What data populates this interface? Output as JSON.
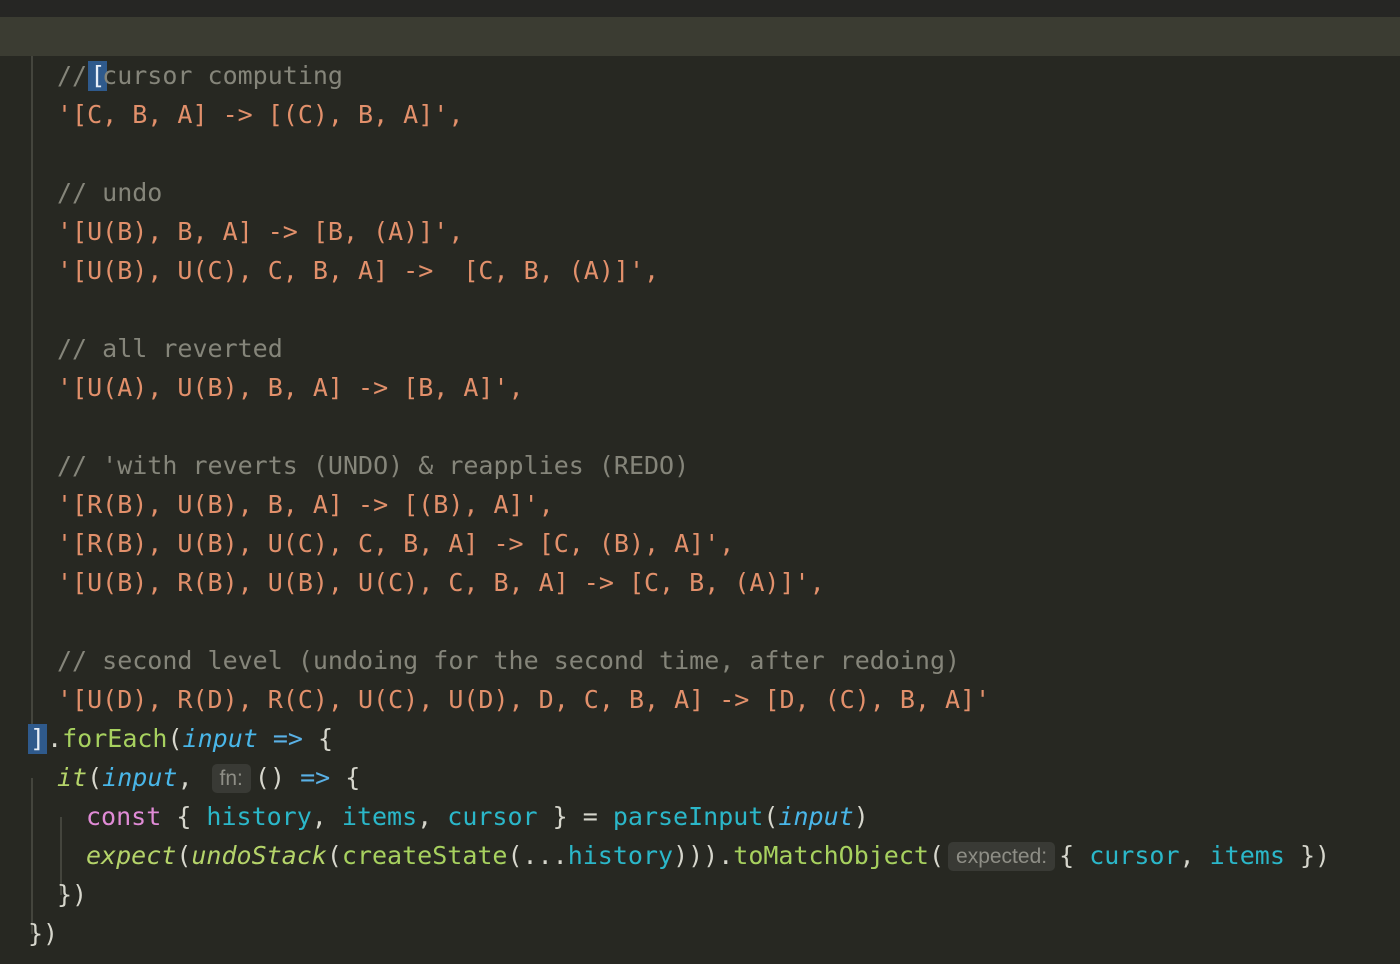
{
  "code": {
    "open_bracket": "[",
    "comment_1": "// cursor computing",
    "string_1": "'[C, B, A] -> [(C), B, A]',",
    "comment_2": "// undo",
    "string_2": "'[U(B), B, A] -> [B, (A)]',",
    "string_3": "'[U(B), U(C), C, B, A] ->  [C, B, (A)]',",
    "comment_3": "// all reverted",
    "string_4": "'[U(A), U(B), B, A] -> [B, A]',",
    "comment_4": "// 'with reverts (UNDO) & reapplies (REDO)",
    "string_5": "'[R(B), U(B), B, A] -> [(B), A]',",
    "string_6": "'[R(B), U(B), U(C), C, B, A] -> [C, (B), A]',",
    "string_7": "'[U(B), R(B), U(B), U(C), C, B, A] -> [C, B, (A)]',",
    "comment_5": "// second level (undoing for the second time, after redoing)",
    "string_8": "'[U(D), R(D), R(C), U(C), U(D), D, C, B, A] -> [D, (C), B, A]'",
    "close_bracket": "]",
    "foreach_dot": ".",
    "foreach_fn": "forEach",
    "foreach_open_paren": "(",
    "foreach_param": "input",
    "foreach_arrow": " => ",
    "foreach_brace": "{",
    "it_fn": "it",
    "it_open": "(",
    "it_param": "input",
    "it_comma": ", ",
    "it_hint": "fn:",
    "it_parens": "() ",
    "it_arrow": "=> ",
    "it_brace": "{",
    "const_kw": "const",
    "const_open": " { ",
    "history_var": "history",
    "comma_a": ", ",
    "items_var": "items",
    "comma_b": ", ",
    "cursor_var": "cursor",
    "const_close": " } = ",
    "parse_fn": "parseInput",
    "parse_open": "(",
    "parse_param": "input",
    "parse_close": ")",
    "expect_fn": "expect",
    "expect_open": "(",
    "undo_fn": "undoStack",
    "undo_open": "(",
    "create_fn": "createState",
    "create_open": "(...",
    "history_var2": "history",
    "close_parens": "))).",
    "match_fn": "toMatchObject",
    "match_open": "(",
    "expected_hint": "expected:",
    "obj_open": "{ ",
    "cursor_var2": "cursor",
    "comma_c": ", ",
    "items_var2": "items",
    "obj_close": " })",
    "it_close": "})",
    "foreach_close": "})"
  }
}
